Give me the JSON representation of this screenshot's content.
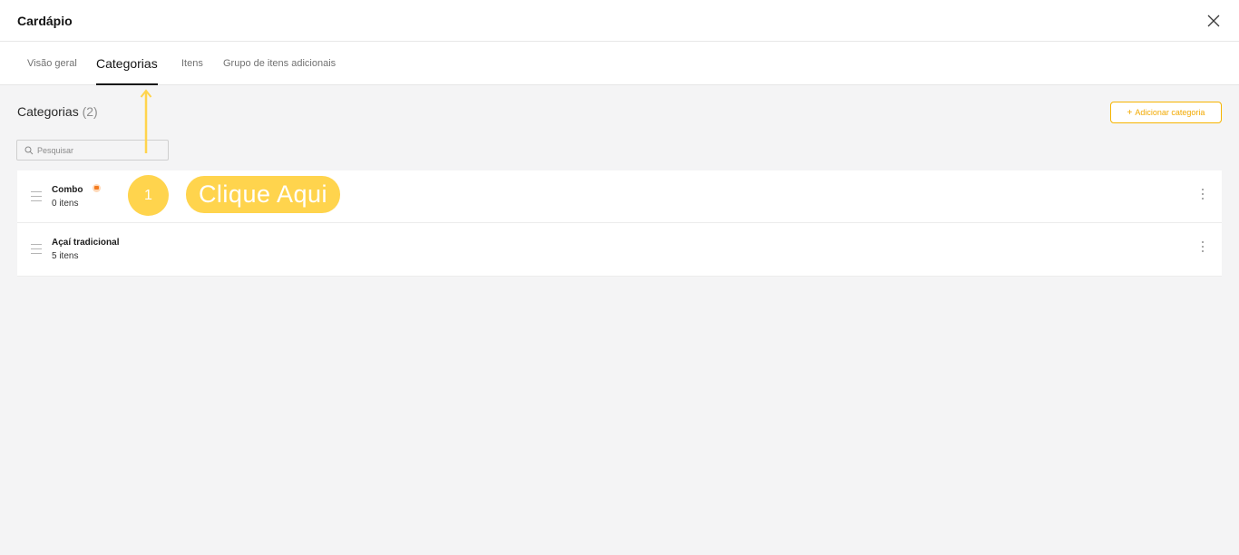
{
  "header": {
    "title": "Cardápio"
  },
  "tabs": [
    {
      "label": "Visão geral"
    },
    {
      "label": "Categorias"
    },
    {
      "label": "Itens"
    },
    {
      "label": "Grupo de itens adicionais"
    }
  ],
  "section": {
    "title": "Categorias",
    "count": "(2)"
  },
  "add_button": {
    "plus": "+",
    "label": "Adicionar categoria"
  },
  "search": {
    "placeholder": "Pesquisar",
    "value": ""
  },
  "categories": [
    {
      "name": "Combo",
      "items": "0 itens",
      "badge_icon": "tag-icon"
    },
    {
      "name": "Açaí tradicional",
      "items": "5 itens"
    }
  ],
  "tutorial": {
    "step": "1",
    "hint": "Clique Aqui"
  },
  "colors": {
    "accent": "#f2a900",
    "highlight": "#ffd44d",
    "badge": "#f47b20"
  }
}
